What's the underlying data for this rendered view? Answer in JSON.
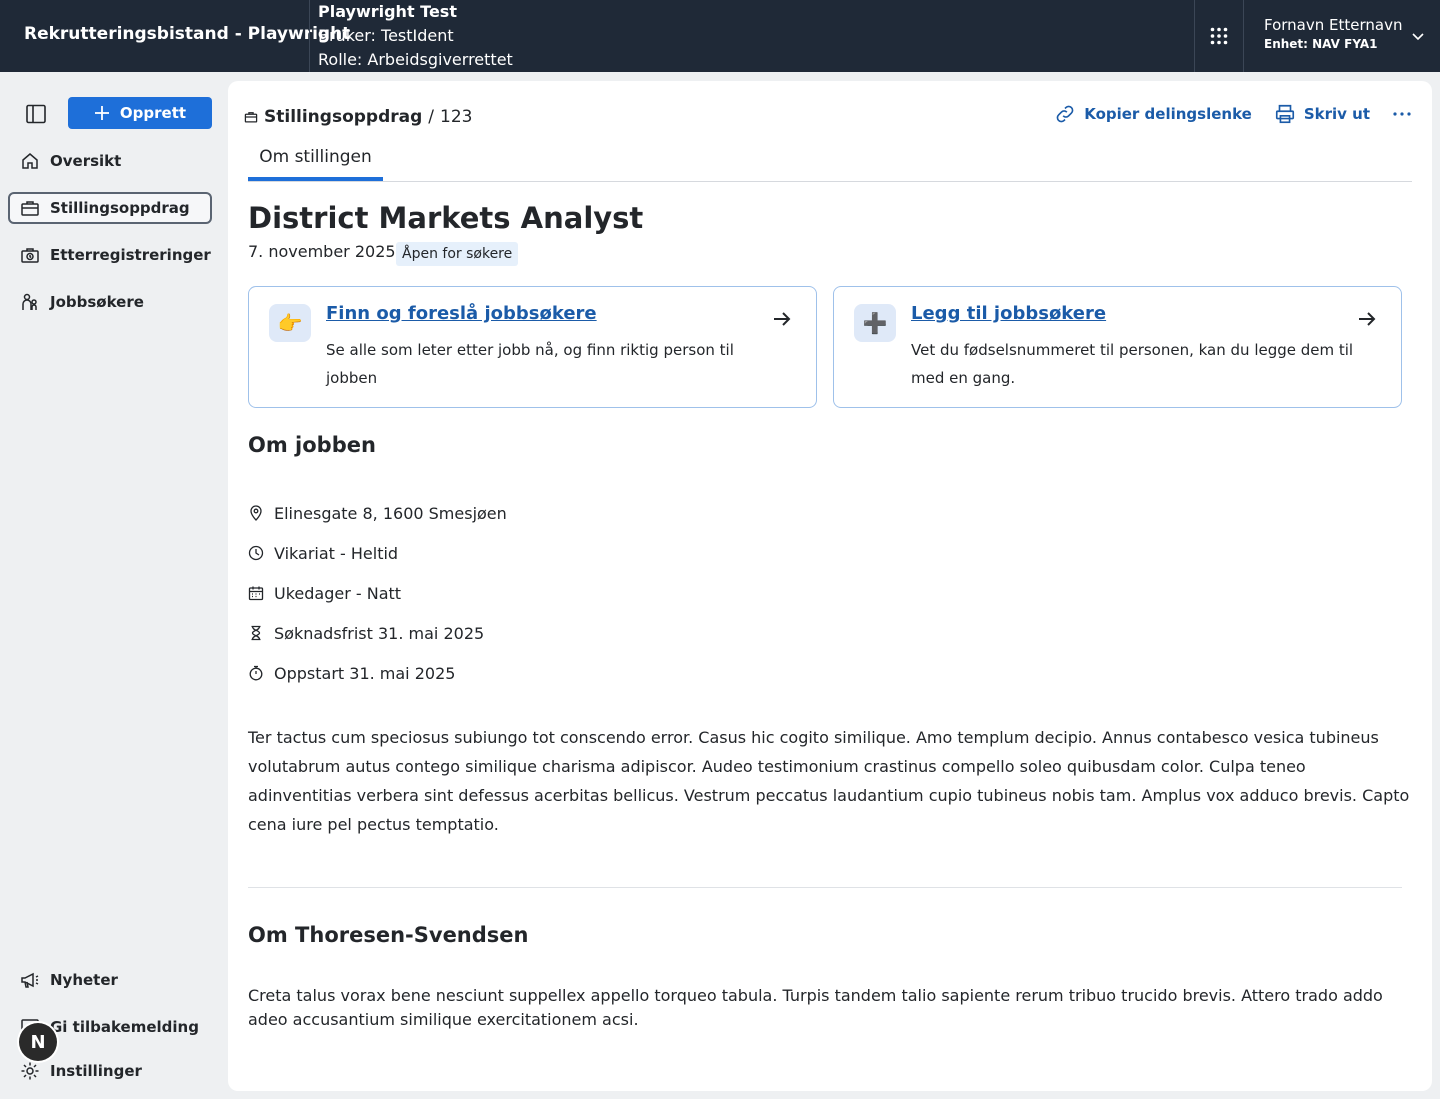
{
  "header": {
    "app_title": "Rekrutteringsbistand - Playwright",
    "test_title": "Playwright Test",
    "test_user": "Bruker: TestIdent",
    "test_role": "Rolle: Arbeidsgiverrettet",
    "user_name": "Fornavn Etternavn",
    "user_unit": "Enhet: NAV FYA1"
  },
  "sidebar": {
    "create_label": "Opprett",
    "items": [
      {
        "label": "Oversikt"
      },
      {
        "label": "Stillingsoppdrag"
      },
      {
        "label": "Etterregistreringer"
      },
      {
        "label": "Jobbsøkere"
      }
    ],
    "bottom_items": [
      {
        "label": "Nyheter"
      },
      {
        "label": "Gi tilbakemelding"
      },
      {
        "label": "Instillinger"
      }
    ],
    "dev_badge": "N"
  },
  "main": {
    "breadcrumb": {
      "link": "Stillingsoppdrag",
      "separator": "/",
      "current": "123"
    },
    "actions": {
      "copy_link": "Kopier delingslenke",
      "print": "Skriv ut"
    },
    "tab": "Om stillingen",
    "title": "District Markets Analyst",
    "date": "7. november 2025",
    "status": "Åpen for søkere",
    "cards": [
      {
        "emoji": "👉",
        "title": "Finn og foreslå jobbsøkere",
        "description": "Se alle som leter etter jobb nå, og finn riktig person til jobben"
      },
      {
        "emoji": "➕",
        "title": "Legg til jobbsøkere",
        "description": "Vet du fødselsnummeret til personen, kan du legge dem til med en gang."
      }
    ],
    "about_job_heading": "Om jobben",
    "facts": [
      {
        "icon": "location-pin-icon",
        "text": "Elinesgate 8, 1600 Smesjøen"
      },
      {
        "icon": "clock-icon",
        "text": "Vikariat - Heltid"
      },
      {
        "icon": "calendar-icon",
        "text": "Ukedager - Natt"
      },
      {
        "icon": "hourglass-icon",
        "text": "Søknadsfrist 31. mai 2025"
      },
      {
        "icon": "stopwatch-icon",
        "text": "Oppstart 31. mai 2025"
      }
    ],
    "job_description": "Ter tactus cum speciosus subiungo tot conscendo error. Casus hic cogito similique. Amo templum decipio. Annus contabesco vesica tubineus volutabrum autus contego similique charisma adipiscor. Audeo testimonium crastinus compello soleo quibusdam color. Culpa teneo adinventitias verbera sint defessus acerbitas bellicus. Vestrum peccatus laudantium cupio tubineus nobis tam. Amplus vox adduco brevis. Capto cena iure pel pectus temptatio.",
    "employer_heading": "Om Thoresen-Svendsen",
    "employer_description": "Creta talus vorax bene nesciunt suppellex appello torqueo tabula. Turpis tandem talio sapiente rerum tribuo trucido brevis. Attero trado addo adeo accusantium similique exercitationem acsi."
  },
  "colors": {
    "header_bg": "#1f2937",
    "accent": "#1e6fd9",
    "link": "#1b5ba8",
    "card_border": "#9fc1ea",
    "badge_bg": "#e6f0fb"
  }
}
